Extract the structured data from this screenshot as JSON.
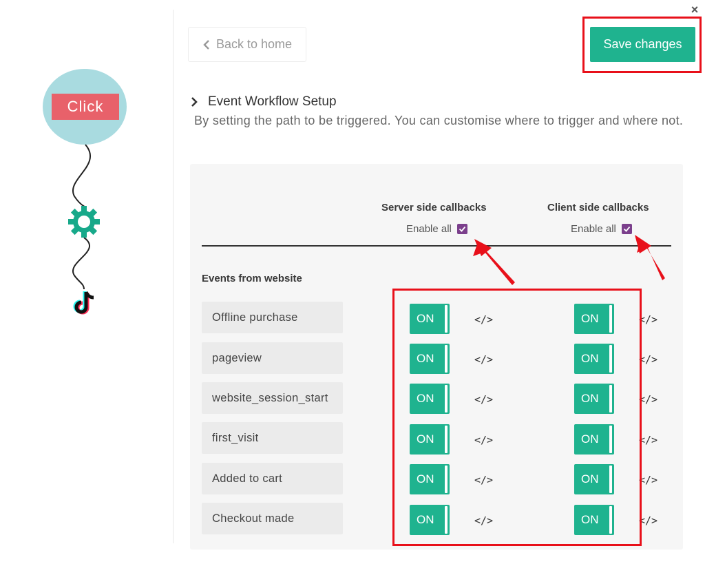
{
  "illustration": {
    "click_label": "Click",
    "icons": [
      "gear-icon",
      "tiktok-icon"
    ]
  },
  "toolbar": {
    "back_label": "Back to home",
    "save_label": "Save changes",
    "close_symbol": "×"
  },
  "section": {
    "title": "Event Workflow Setup",
    "description": "By setting the path to be triggered. You can customise where to trigger and where not."
  },
  "table": {
    "server_header": "Server side callbacks",
    "client_header": "Client side callbacks",
    "enable_all_label": "Enable all",
    "server_enable_all_checked": true,
    "client_enable_all_checked": true,
    "group_label": "Events from website",
    "code_symbol": "</>",
    "rows": [
      {
        "event": "Offline purchase",
        "server": "ON",
        "client": "ON"
      },
      {
        "event": "pageview",
        "server": "ON",
        "client": "ON"
      },
      {
        "event": "website_session_start",
        "server": "ON",
        "client": "ON"
      },
      {
        "event": "first_visit",
        "server": "ON",
        "client": "ON"
      },
      {
        "event": "Added to cart",
        "server": "ON",
        "client": "ON"
      },
      {
        "event": "Checkout made",
        "server": "ON",
        "client": "ON"
      }
    ]
  },
  "colors": {
    "accent": "#1fb38f",
    "highlight": "#e8101a",
    "checkbox": "#7b3f8c",
    "click_badge": "#e8616a",
    "click_circle": "#a9dbe0"
  }
}
